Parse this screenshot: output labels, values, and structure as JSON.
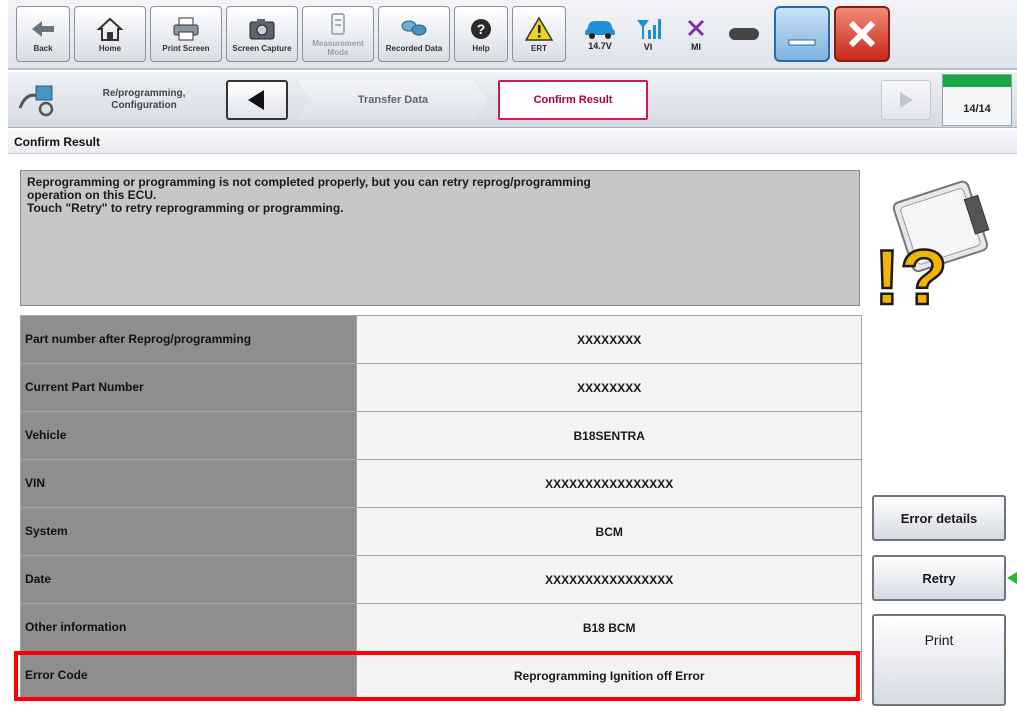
{
  "toolbar": {
    "back": "Back",
    "home": "Home",
    "print_screen": "Print Screen",
    "screen_capture": "Screen Capture",
    "measurement_mode": "Measurement Mode",
    "recorded_data": "Recorded Data",
    "help": "Help",
    "ert": "ERT",
    "battery_voltage": "14.7V",
    "vi": "VI",
    "mi": "MI"
  },
  "nav": {
    "section": "Re/programming, Configuration",
    "steps": [
      "Transfer Data",
      "Confirm Result"
    ],
    "page_indicator": "14/14",
    "progress": 1.0
  },
  "page_title": "Confirm Result",
  "message": {
    "line1": "Reprogramming or programming is not completed properly, but you can retry reprog/programming",
    "line2": "operation on this ECU.",
    "line3": "Touch \"Retry\" to retry reprogramming or programming."
  },
  "results": [
    {
      "key": "Part number after Reprog/programming",
      "value": "XXXXXXXX"
    },
    {
      "key": "Current Part Number",
      "value": "XXXXXXXX"
    },
    {
      "key": "Vehicle",
      "value": "B18SENTRA"
    },
    {
      "key": "VIN",
      "value": "XXXXXXXXXXXXXXXX"
    },
    {
      "key": "System",
      "value": "BCM"
    },
    {
      "key": "Date",
      "value": "XXXXXXXXXXXXXXXX"
    },
    {
      "key": "Other information",
      "value": "B18 BCM"
    },
    {
      "key": "Error Code",
      "value": "Reprogramming Ignition off Error"
    }
  ],
  "buttons": {
    "error_details": "Error details",
    "retry": "Retry",
    "print": "Print"
  },
  "colors": {
    "highlight": "#ff0000",
    "progress": "#14a846",
    "active_step": "#d2194f"
  }
}
